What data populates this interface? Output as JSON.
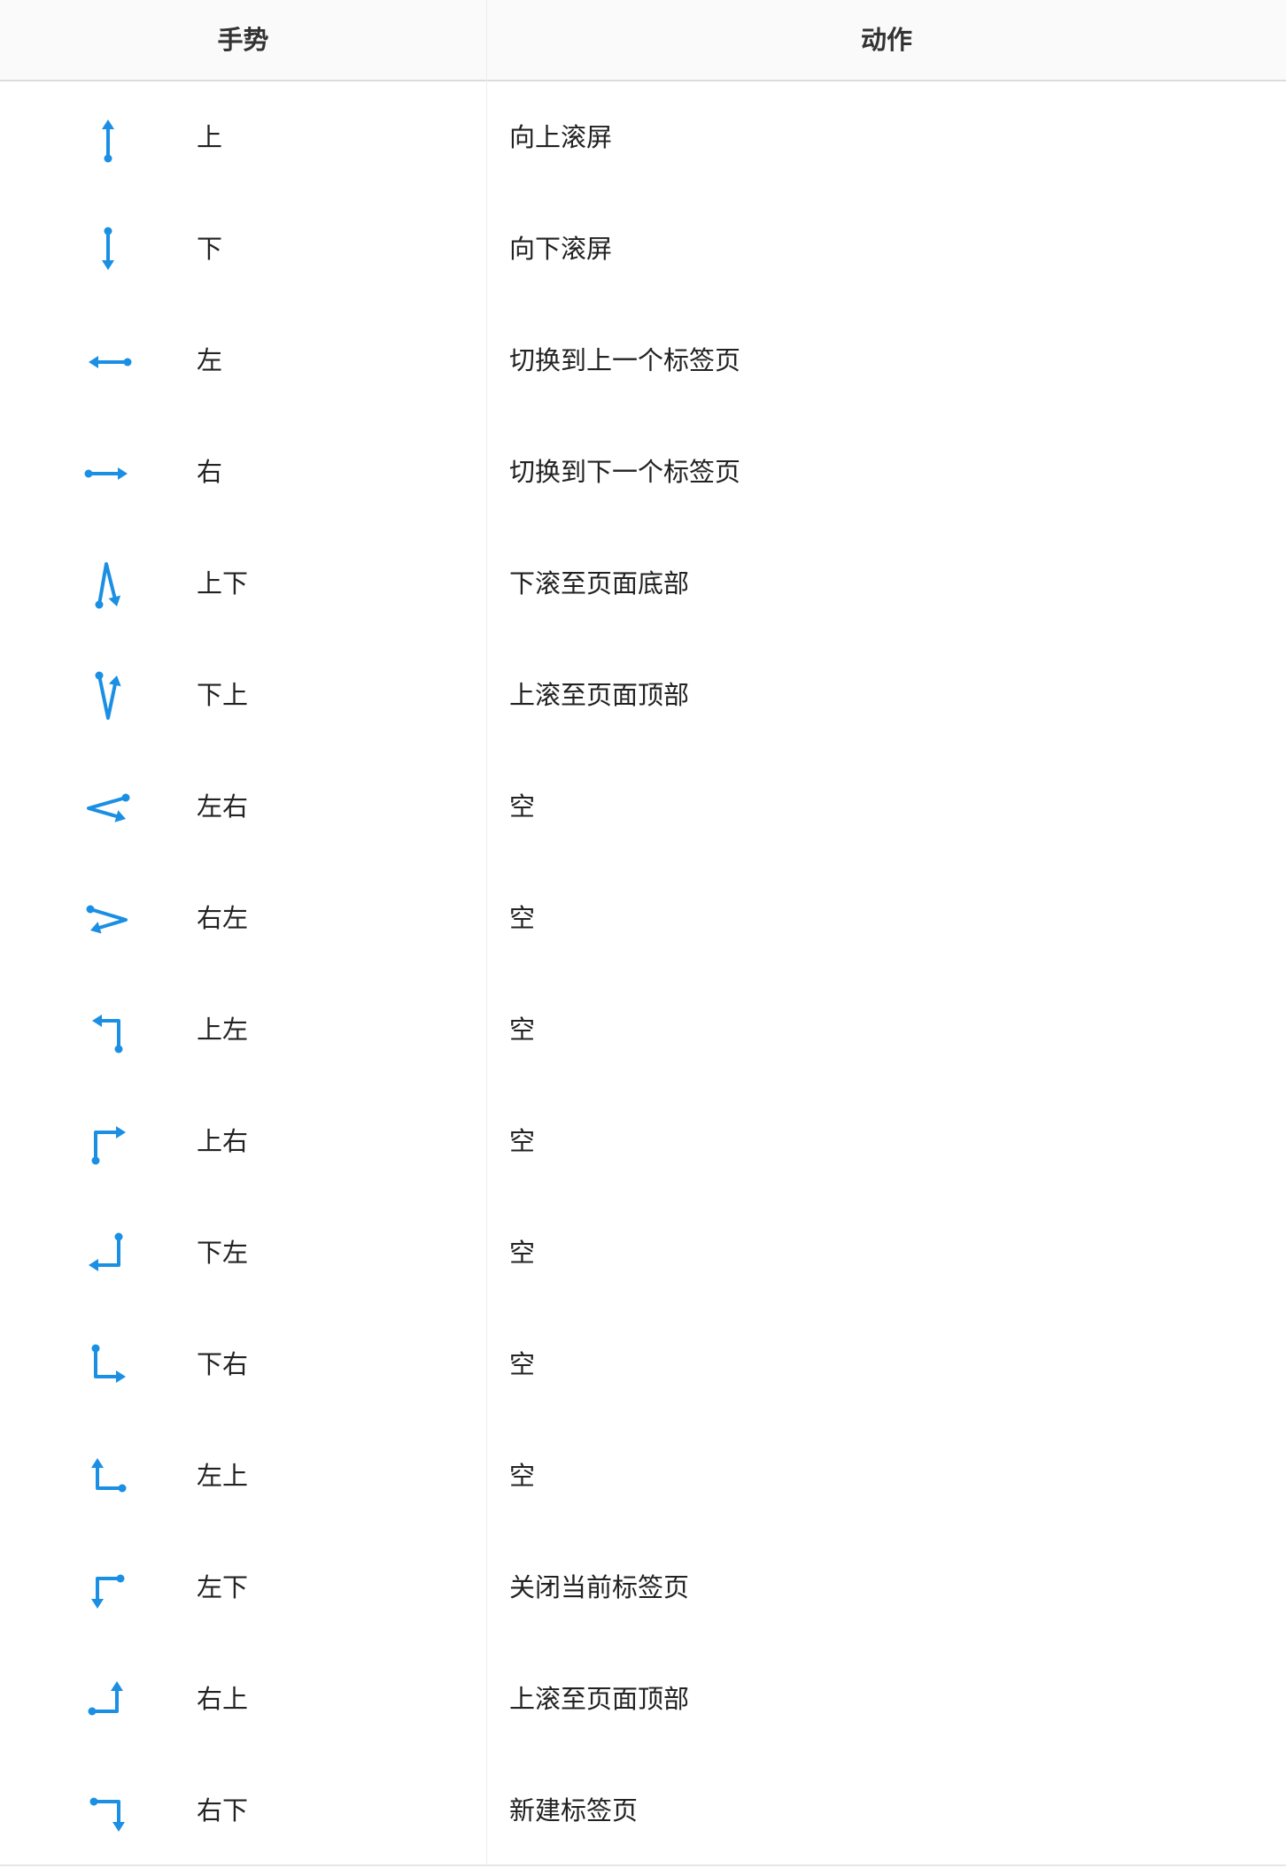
{
  "header": {
    "gesture": "手势",
    "action": "动作"
  },
  "colors": {
    "icon": "#1a8fe3",
    "header_bg": "#fafafa",
    "border": "#dcdcdc"
  },
  "rows": [
    {
      "icon": "arrow-up-icon",
      "gesture": "上",
      "action": "向上滚屏"
    },
    {
      "icon": "arrow-down-icon",
      "gesture": "下",
      "action": "向下滚屏"
    },
    {
      "icon": "arrow-left-icon",
      "gesture": "左",
      "action": "切换到上一个标签页"
    },
    {
      "icon": "arrow-right-icon",
      "gesture": "右",
      "action": "切换到下一个标签页"
    },
    {
      "icon": "up-down-gesture-icon",
      "gesture": "上下",
      "action": "下滚至页面底部"
    },
    {
      "icon": "down-up-gesture-icon",
      "gesture": "下上",
      "action": "上滚至页面顶部"
    },
    {
      "icon": "left-right-gesture-icon",
      "gesture": "左右",
      "action": "空"
    },
    {
      "icon": "right-left-gesture-icon",
      "gesture": "右左",
      "action": "空"
    },
    {
      "icon": "up-left-gesture-icon",
      "gesture": "上左",
      "action": "空"
    },
    {
      "icon": "up-right-gesture-icon",
      "gesture": "上右",
      "action": "空"
    },
    {
      "icon": "down-left-gesture-icon",
      "gesture": "下左",
      "action": "空"
    },
    {
      "icon": "down-right-gesture-icon",
      "gesture": "下右",
      "action": "空"
    },
    {
      "icon": "left-up-gesture-icon",
      "gesture": "左上",
      "action": "空"
    },
    {
      "icon": "left-down-gesture-icon",
      "gesture": "左下",
      "action": "关闭当前标签页"
    },
    {
      "icon": "right-up-gesture-icon",
      "gesture": "右上",
      "action": "上滚至页面顶部"
    },
    {
      "icon": "right-down-gesture-icon",
      "gesture": "右下",
      "action": "新建标签页"
    }
  ]
}
